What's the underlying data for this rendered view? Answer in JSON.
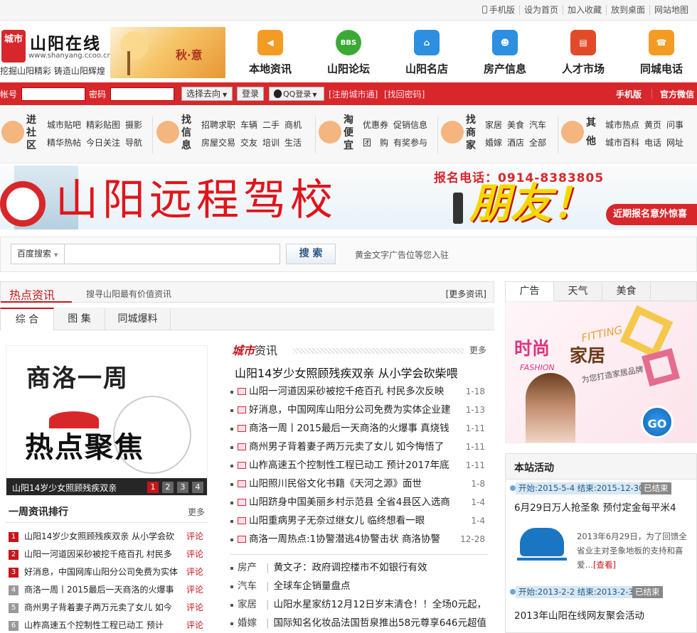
{
  "topbar": {
    "links": [
      "手机版",
      "设为首页",
      "加入收藏",
      "放到桌面",
      "网站地图"
    ]
  },
  "logo": {
    "name": "山阳在线",
    "badge": "城市",
    "url": "www.shanyang.ccoo.cn",
    "slogan": "挖掘山阳精彩 铸造山阳辉煌",
    "season": "秋·意"
  },
  "nav": [
    {
      "label": "本地资讯",
      "icon": "megaphone-icon",
      "color": "#f39c24"
    },
    {
      "label": "山阳论坛",
      "icon": "bbs-icon",
      "color": "#3aaa35",
      "text": "BBS"
    },
    {
      "label": "山阳名店",
      "icon": "house-icon",
      "color": "#2c8fe0"
    },
    {
      "label": "房产信息",
      "icon": "people-icon",
      "color": "#2c8fe0"
    },
    {
      "label": "人才市场",
      "icon": "cart-icon",
      "color": "#e14b2a"
    },
    {
      "label": "同城电话",
      "icon": "phone-icon",
      "color": "#f39c24"
    }
  ],
  "login": {
    "user_label": "帐号",
    "pass_label": "密码",
    "goto": "选择去向",
    "login_btn": "登录",
    "qq": "QQ登录",
    "register": "[注册城市通]",
    "forgot": "[找回密码]",
    "mobile": "手机版",
    "weixin": "官方微信"
  },
  "categories": [
    {
      "title": "进社区",
      "links": [
        [
          "城市贴吧",
          "精彩贴图",
          "摄影"
        ],
        [
          "精华热帖",
          "今日关注",
          "导航"
        ]
      ]
    },
    {
      "title": "找信息",
      "links": [
        [
          "招聘求职",
          "车辆",
          "二手",
          "商机"
        ],
        [
          "房屋交易",
          "交友",
          "培训",
          "生活"
        ]
      ]
    },
    {
      "title": "淘便宜",
      "links": [
        [
          "优惠券",
          "促销信息"
        ],
        [
          "团　购",
          "有奖参与"
        ]
      ]
    },
    {
      "title": "找商家",
      "links": [
        [
          "家居",
          "美食",
          "汽车"
        ],
        [
          "婚嫁",
          "酒店",
          "全部"
        ]
      ]
    },
    {
      "title": "其他",
      "links": [
        [
          "城市热点",
          "黄页",
          "问事"
        ],
        [
          "城市百科",
          "电话",
          "网址"
        ]
      ]
    }
  ],
  "banner": {
    "phone": "报名电话：0914-8383805",
    "school": "山阳远程驾校",
    "slogan": "朋友！",
    "promo": "近期报名意外惊喜"
  },
  "search": {
    "engine": "百度搜索",
    "button": "搜 索",
    "ad": "黄金文字广告位等您入驻"
  },
  "hot": {
    "title": "热点资讯",
    "subtitle": "搜寻山阳最有价值资讯",
    "more": "[更多资讯]",
    "tabs": [
      "综 合",
      "图 集",
      "同城爆料"
    ]
  },
  "slide": {
    "caption": "山阳14岁少女照顾残疾双亲",
    "pages": [
      "1",
      "2",
      "3",
      "4"
    ],
    "title_line1": "商洛一周",
    "title_line2": "热点聚焦"
  },
  "city": {
    "title_a": "城市",
    "title_b": "资讯",
    "more": "更多",
    "headline": "山阳14岁少女照顾残疾双亲 从小学会砍柴喂",
    "items": [
      {
        "t": "山阳一河道因采砂被挖千疮百孔 村民多次反映",
        "d": "1-18"
      },
      {
        "t": "好消息，中国网库山阳分公司免费为实体企业建",
        "d": "1-13"
      },
      {
        "t": "商洛一周丨2015最后一天商洛的火爆事 真烧钱",
        "d": "1-11"
      },
      {
        "t": "商州男子背着妻子两万元卖了女儿 如今悔悟了",
        "d": "1-11"
      },
      {
        "t": "山柞高速五个控制性工程已动工 预计2017年底",
        "d": "1-11"
      },
      {
        "t": "山阳照川民俗文化书籍《天河之源》面世",
        "d": "1-8"
      },
      {
        "t": "山阳跻身中国美丽乡村示范县 全省4县区入选商",
        "d": "1-4"
      },
      {
        "t": "山阳重病男子无奈过继女儿 临终想看一眼",
        "d": "1-4"
      },
      {
        "t": "商洛一周热点:1协警潜逃4协警击状 商洛协警",
        "d": "12-28"
      }
    ],
    "cats": [
      {
        "k": "房产",
        "t": "黄文孑：政府调控楼市不如银行有效"
      },
      {
        "k": "汽车",
        "t": "全球车企销量盘点"
      },
      {
        "k": "家居",
        "t": "山阳水星家纺12月12日岁末清仓！！全场0元起，"
      },
      {
        "k": "婚嫁",
        "t": "国际知名化妆品法国哲泉推出58元尊享646元超值"
      }
    ]
  },
  "rank": {
    "title": "一周资讯排行",
    "more": "更多",
    "comment": "评论",
    "items": [
      "山阳14岁少女照顾残疾双亲 从小学会砍",
      "山阳一河道因采砂被挖千疮百孔 村民多",
      "好消息，中国网库山阳分公司免费为实体",
      "商洛一周丨2015最后一天商洛的火爆事",
      "商州男子背着妻子两万元卖了女儿 如今",
      "山柞高速五个控制性工程已动工 预计"
    ]
  },
  "side": {
    "tabs": [
      "广告",
      "天气",
      "美食"
    ],
    "ad": {
      "t1": "时尚",
      "t2": "家居",
      "t3": "FITTING",
      "t4": "FASHION",
      "t5": "为您打造家居品牌",
      "go": "GO"
    },
    "activity_title": "本站活动",
    "acts": [
      {
        "date": "开始:2015-5-4 结束:2015-12-30",
        "status": "已结束",
        "title": "6月29日万人抢圣象 预付定金每平米4",
        "desc": "2013年6月29日，为了回馈全省业主对圣象地板的支持和喜爱…",
        "more": "[查看]"
      },
      {
        "date": "开始:2013-2-2 结束:2013-2-3",
        "status": "已结束",
        "title": "2013年山阳在线网友聚会活动"
      }
    ]
  }
}
